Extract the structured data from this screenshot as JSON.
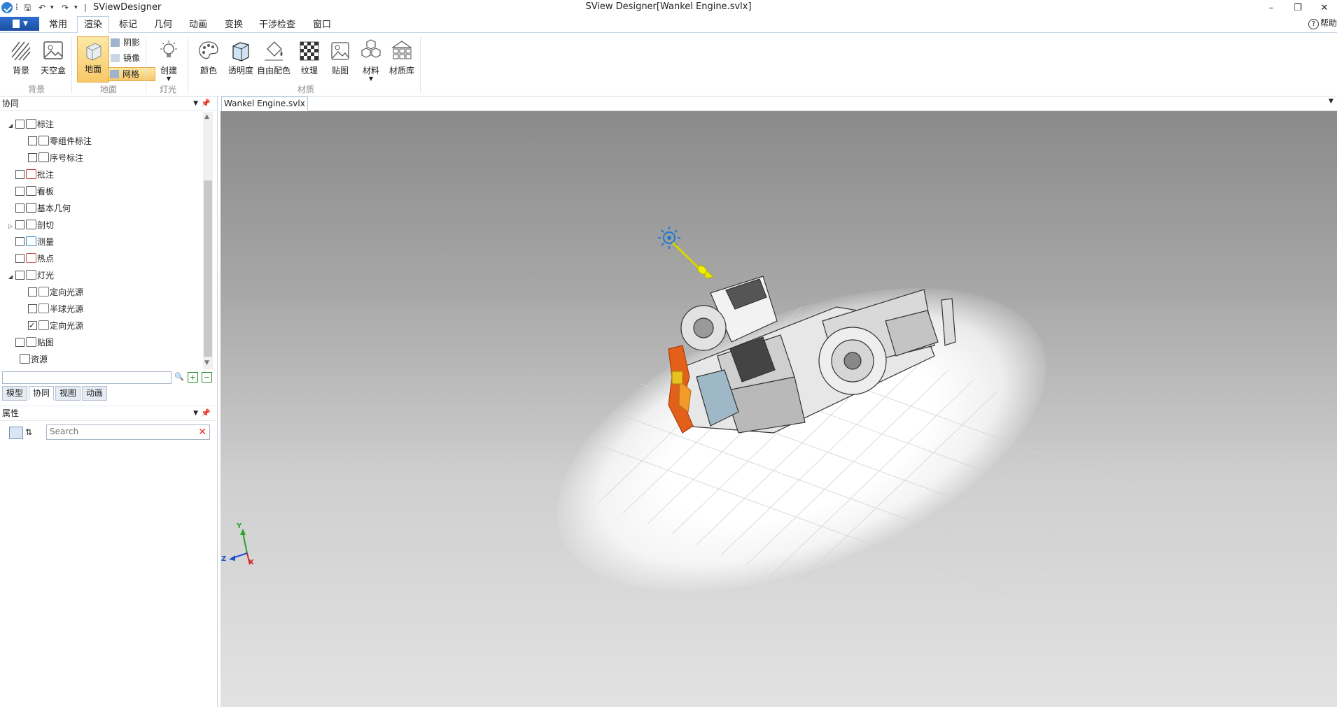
{
  "titlebar": {
    "app_name": "SViewDesigner",
    "window_title": "SView Designer[Wankel Engine.svlx]",
    "minimize": "–",
    "restore": "❐",
    "close": "✕"
  },
  "menu": {
    "tabs": [
      "常用",
      "渲染",
      "标记",
      "几何",
      "动画",
      "变换",
      "干涉检查",
      "窗口"
    ],
    "active": "渲染",
    "help": "帮助"
  },
  "ribbon": {
    "background": {
      "label": "背景",
      "buttons": [
        "背景",
        "天空盒"
      ]
    },
    "ground": {
      "label": "地面",
      "main": "地面",
      "small": [
        "阴影",
        "镜像",
        "网格"
      ]
    },
    "light": {
      "label": "灯光",
      "buttons": [
        "创建"
      ]
    },
    "material": {
      "label": "材质",
      "buttons": [
        "颜色",
        "透明度",
        "自由配色",
        "纹理",
        "贴图",
        "材料",
        "材质库"
      ]
    }
  },
  "left_pane": {
    "title": "协同",
    "tree": [
      {
        "label": "标注",
        "level": 0,
        "expand": "◢",
        "checked": false
      },
      {
        "label": "零组件标注",
        "level": 1,
        "checked": false
      },
      {
        "label": "序号标注",
        "level": 1,
        "checked": false
      },
      {
        "label": "批注",
        "level": 0,
        "checked": false
      },
      {
        "label": "看板",
        "level": 0,
        "checked": false
      },
      {
        "label": "基本几何",
        "level": 0,
        "checked": false
      },
      {
        "label": "剖切",
        "level": 0,
        "expand": "▷",
        "checked": false
      },
      {
        "label": "测量",
        "level": 0,
        "checked": false
      },
      {
        "label": "热点",
        "level": 0,
        "checked": false
      },
      {
        "label": "灯光",
        "level": 0,
        "expand": "◢",
        "checked": false
      },
      {
        "label": "定向光源",
        "level": 1,
        "checked": false
      },
      {
        "label": "半球光源",
        "level": 1,
        "checked": false
      },
      {
        "label": "定向光源",
        "level": 1,
        "checked": true
      },
      {
        "label": "贴图",
        "level": 0,
        "checked": false
      },
      {
        "label": "资源",
        "level": 0,
        "nocheck": true
      }
    ],
    "tabs": [
      "模型",
      "协同",
      "视图",
      "动画"
    ],
    "active_tab": "协同"
  },
  "properties": {
    "title": "属性",
    "search_placeholder": "Search"
  },
  "document": {
    "tab": "Wankel Engine.svlx",
    "axes": {
      "x": "X",
      "y": "Y",
      "z": "Z"
    }
  },
  "colors": {
    "accent": "#2e6ecf",
    "ground_active": "#f8c86a",
    "light_arrow": "#e6e600"
  }
}
